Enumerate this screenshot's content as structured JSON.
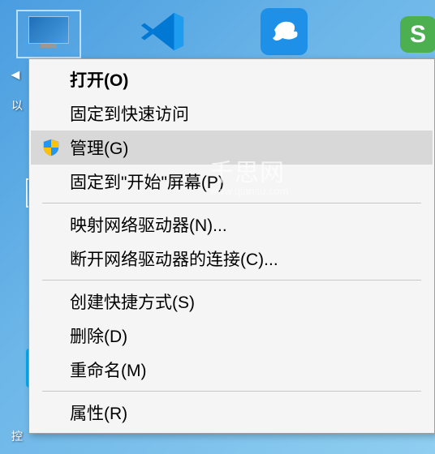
{
  "desktop": {
    "thispc_label_partial": "以",
    "control_label_partial": "控",
    "green_letter": "S"
  },
  "watermark": {
    "line1": "千思网",
    "line2": "www.qiansu.com"
  },
  "menu": {
    "open": "打开(O)",
    "pin_quick": "固定到快速访问",
    "manage": "管理(G)",
    "pin_start": "固定到\"开始\"屏幕(P)",
    "map_drive": "映射网络驱动器(N)...",
    "disconnect_drive": "断开网络驱动器的连接(C)...",
    "create_shortcut": "创建快捷方式(S)",
    "delete": "删除(D)",
    "rename": "重命名(M)",
    "properties": "属性(R)"
  }
}
